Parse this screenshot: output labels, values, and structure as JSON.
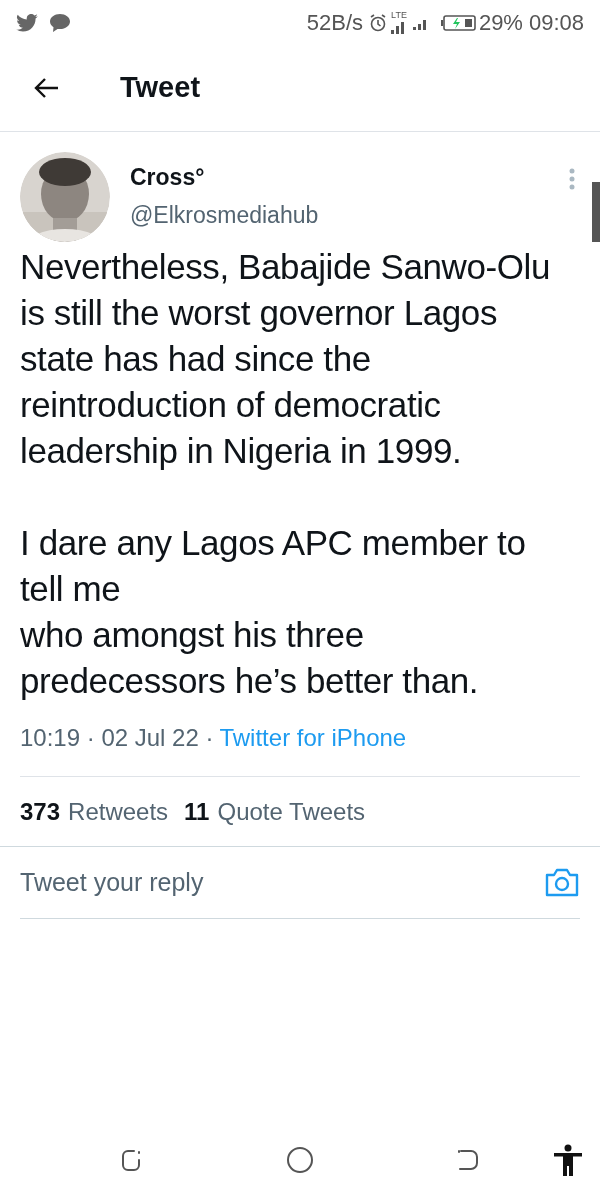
{
  "status_bar": {
    "speed": "52B/s",
    "network": "LTE",
    "battery": "29%",
    "time": "09:08"
  },
  "header": {
    "title": "Tweet"
  },
  "tweet": {
    "name": "Cross°",
    "handle": "@Elkrosmediahub",
    "text": "Nevertheless, Babajide Sanwo-Olu is still the worst governor Lagos state has had since the reintroduction of democratic leadership in Nigeria in 1999.\n\nI dare any Lagos APC member to tell me\nwho amongst his three predecessors he’s better than.",
    "timestamp": "10:19 · 02 Jul 22 ·",
    "source": "Twitter for iPhone"
  },
  "stats": [
    {
      "count": "373",
      "label": "Retweets"
    },
    {
      "count": "11",
      "label": "Quote Tweets"
    }
  ],
  "reply": {
    "placeholder": "Tweet your reply"
  }
}
